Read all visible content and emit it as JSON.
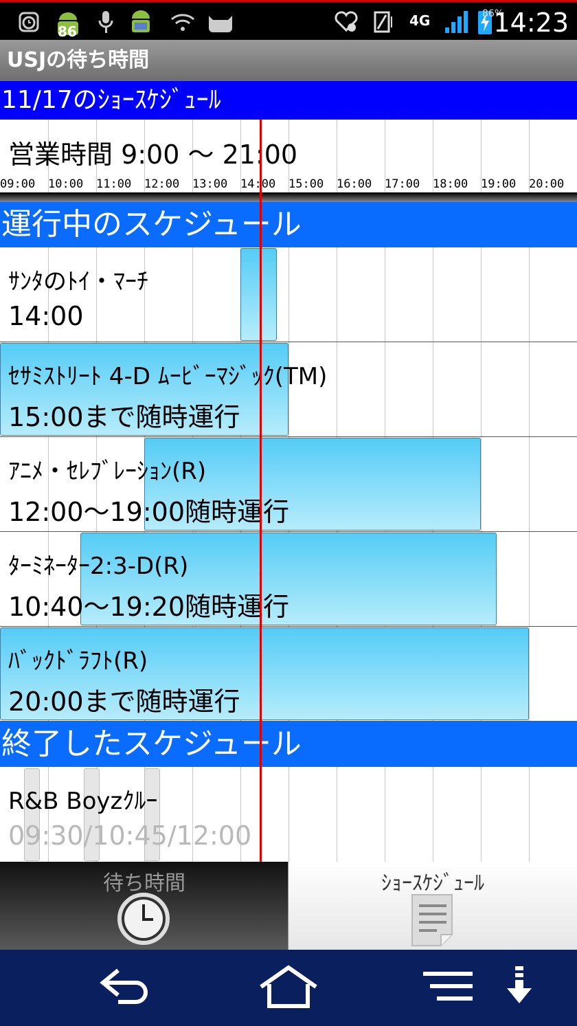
{
  "status_bar": {
    "badge": "86",
    "battery_percent": "86%",
    "network": "4G",
    "clock": "14:23"
  },
  "app": {
    "title": "USJの待ち時間"
  },
  "schedule": {
    "header": "11/17のｼｮｰｽｹｼﾞｭｰﾙ",
    "hours_title": "営業時間 9:00 ～ 21:00",
    "ticks": [
      "09:00",
      "10:00",
      "11:00",
      "12:00",
      "13:00",
      "14:00",
      "15:00",
      "16:00",
      "17:00",
      "18:00",
      "19:00",
      "20:00"
    ]
  },
  "sections": {
    "running": "運行中のスケジュール",
    "ended": "終了したスケジュール"
  },
  "running_items": [
    {
      "name": "ｻﾝﾀのﾄｲ・ﾏｰﾁ",
      "time": "14:00"
    },
    {
      "name": "ｾｻﾐｽﾄﾘｰﾄ 4-D ﾑｰﾋﾞｰﾏｼﾞｯｸ(TM)",
      "time": "15:00まで随時運行"
    },
    {
      "name": "ｱﾆﾒ・ｾﾚﾌﾞﾚｰｼｮﾝ(R)",
      "time": "12:00～19:00随時運行"
    },
    {
      "name": "ﾀｰﾐﾈｰﾀｰ2:3-D(R)",
      "time": "10:40～19:20随時運行"
    },
    {
      "name": "ﾊﾞｯｸﾄﾞﾗﾌﾄ(R)",
      "time": "20:00まで随時運行"
    }
  ],
  "ended_items": [
    {
      "name": "R&B Boyzｸﾙｰ",
      "time": "09:30/10:45/12:00"
    }
  ],
  "tabs": {
    "wait_label": "待ち時間",
    "show_label": "ｼｮｰｽｹｼﾞｭｰﾙ"
  }
}
